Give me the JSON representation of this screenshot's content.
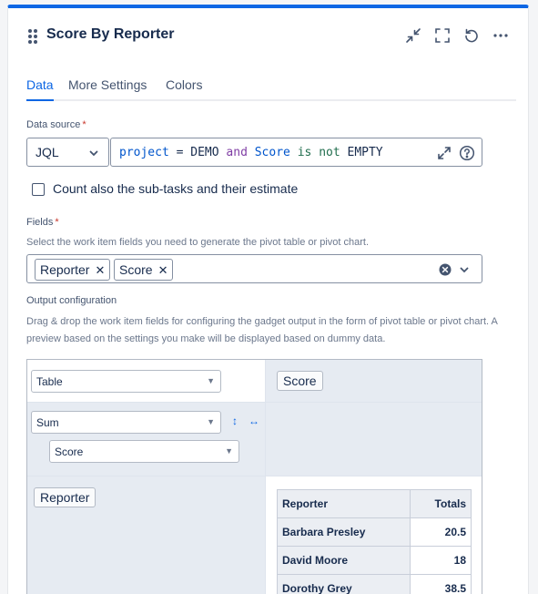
{
  "gadget": {
    "title": "Score By Reporter"
  },
  "tabs": [
    {
      "label": "Data",
      "active": true
    },
    {
      "label": "More Settings",
      "active": false
    },
    {
      "label": "Colors",
      "active": false
    }
  ],
  "data_source": {
    "label": "Data source",
    "required_mark": "*",
    "type": "JQL",
    "query_tokens": [
      "project",
      "=",
      "DEMO",
      "and",
      "Score",
      "is",
      "not",
      "EMPTY"
    ]
  },
  "subtasks_checkbox": {
    "label": "Count also the sub-tasks and their estimate",
    "checked": false
  },
  "fields": {
    "label": "Fields",
    "required_mark": "*",
    "help": "Select the work item fields you need to generate the pivot table or pivot chart.",
    "selected": [
      "Reporter",
      "Score"
    ]
  },
  "output_config": {
    "label": "Output configuration",
    "help": "Drag & drop the work item fields for configuring the gadget output in the form of pivot table or pivot chart. A preview based on the settings you make will be displayed based on dummy data.",
    "renderer": "Table",
    "column_field": "Score",
    "aggregator": "Sum",
    "aggregator_field": "Score",
    "row_field": "Reporter",
    "preview": {
      "header_row": "Reporter",
      "header_totals": "Totals",
      "rows": [
        {
          "name": "Barbara Presley",
          "value": "20.5"
        },
        {
          "name": "David Moore",
          "value": "18"
        },
        {
          "name": "Dorothy Grey",
          "value": "38.5"
        }
      ]
    }
  },
  "colors": {
    "accent": "#0c66e4",
    "text": "#172b4d",
    "subtle": "#44546f",
    "required": "#c9372c"
  }
}
